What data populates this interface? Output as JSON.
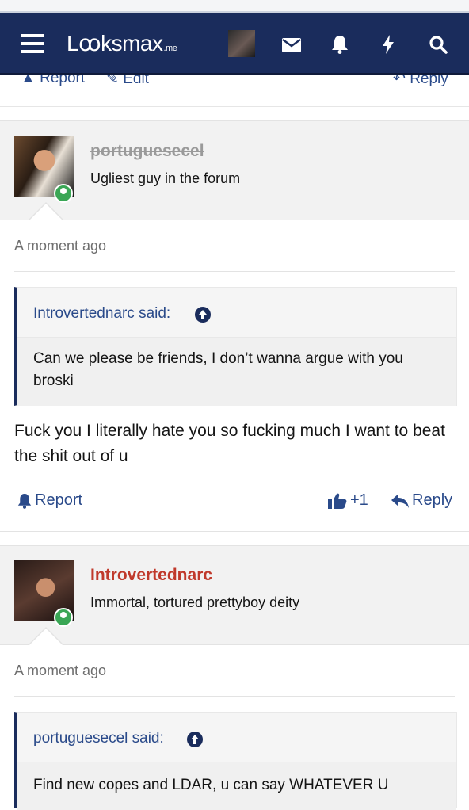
{
  "header": {
    "logo_text": "Lꝏksmax",
    "logo_suffix": ".me",
    "icons": [
      "menu-icon",
      "avatar",
      "mail-icon",
      "bell-icon",
      "lightning-icon",
      "search-icon"
    ],
    "brand_color": "#1a2c5c"
  },
  "previous_post_actions": {
    "report_label": "Report",
    "edit_label": "Edit",
    "reply_label": "Reply"
  },
  "posts": [
    {
      "username": "portuguesecel",
      "user_title": "Ugliest guy in the forum",
      "timestamp": "A moment ago",
      "quote": {
        "author_line": "Introvertednarc said:",
        "text": "Can we please be friends, I don’t wanna argue with you broski"
      },
      "body": "Fuck you I literally hate you so fucking much I want to beat the shit out of u",
      "actions": {
        "report_label": "Report",
        "reaction_count": "+1",
        "reply_label": "Reply"
      }
    },
    {
      "username": "Introvertednarc",
      "user_title": "Immortal, tortured prettyboy deity",
      "timestamp": "A moment ago",
      "quote": {
        "author_line": "portuguesecel said:",
        "text": "Find new copes and LDAR, u can say WHATEVER U"
      }
    }
  ]
}
